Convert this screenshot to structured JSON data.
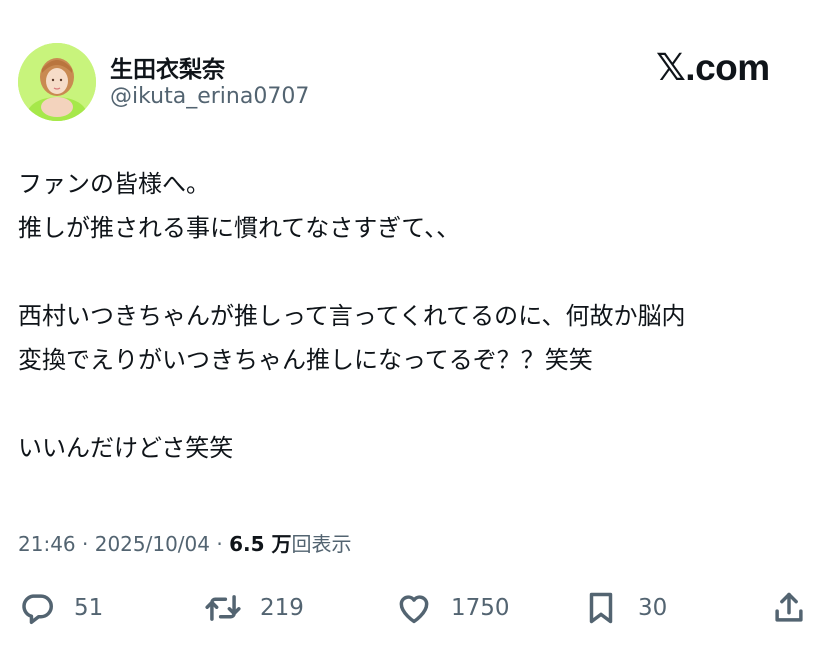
{
  "author": {
    "display_name": "生田衣梨奈",
    "handle": "@ikuta_erina0707",
    "avatar": "profile-photo"
  },
  "brand": "𝕏.com",
  "post": {
    "lines": [
      "ファンの皆様へ。",
      "推しが推される事に慣れてなさすぎて、、",
      "",
      "西村いつきちゃんが推しって言ってくれてるのに、何故か脳内",
      "変換でえりがいつきちゃん推しになってるぞ？？笑笑",
      "",
      "いいんだけどさ笑笑"
    ]
  },
  "meta": {
    "time": "21:46",
    "separator": "·",
    "date": "2025/10/04",
    "views_count": "6.5 万",
    "views_label": "回表示"
  },
  "actions": [
    {
      "name": "reply",
      "icon": "reply-icon",
      "count": "51"
    },
    {
      "name": "retweet",
      "icon": "retweet-icon",
      "count": "219"
    },
    {
      "name": "like",
      "icon": "heart-icon",
      "count": "1750"
    },
    {
      "name": "bookmark",
      "icon": "bookmark-icon",
      "count": "30"
    },
    {
      "name": "share",
      "icon": "share-icon",
      "count": ""
    }
  ],
  "colors": {
    "text": "#0f1419",
    "secondary": "#536471",
    "avatar_bg": "#c6f27a"
  }
}
